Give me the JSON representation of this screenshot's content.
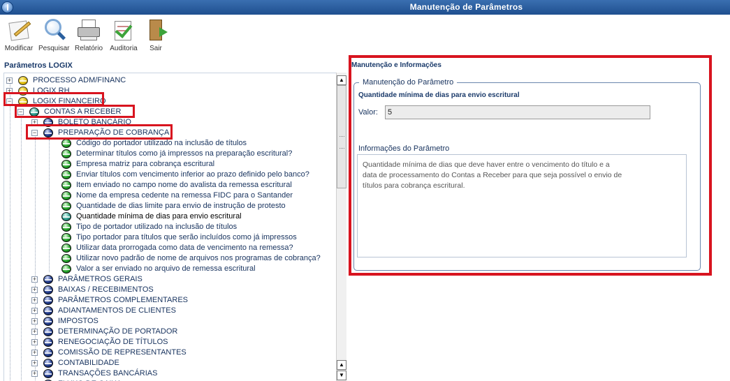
{
  "window": {
    "title": "Manutenção de Parâmetros"
  },
  "toolbar": {
    "modify": {
      "label": "Modificar",
      "icon": "edit-pen-icon"
    },
    "search": {
      "label": "Pesquisar",
      "icon": "magnifier-icon"
    },
    "report": {
      "label": "Relatório",
      "icon": "printer-icon"
    },
    "audit": {
      "label": "Auditoria",
      "icon": "checklist-icon"
    },
    "exit": {
      "label": "Sair",
      "icon": "exit-door-icon"
    }
  },
  "left_panel": {
    "title": "Parâmetros LOGIX",
    "tree": [
      {
        "label": "PROCESSO ADM/FINANC",
        "level": 0,
        "toggle": "+",
        "ball": "yellow"
      },
      {
        "label": "LOGIX RH",
        "level": 0,
        "toggle": "+",
        "ball": "yellow"
      },
      {
        "label": "LOGIX FINANCEIRO",
        "level": 0,
        "toggle": "-",
        "ball": "yellow"
      },
      {
        "label": "CONTAS A RECEBER",
        "level": 1,
        "toggle": "-",
        "ball": "teal"
      },
      {
        "label": "BOLETO BANCÁRIO",
        "level": 2,
        "toggle": "+",
        "ball": "navy"
      },
      {
        "label": "PREPARAÇÃO DE COBRANÇA",
        "level": 2,
        "toggle": "-",
        "ball": "navy"
      },
      {
        "label": "Código do portador utilizado na inclusão de títulos",
        "level": 3,
        "ball": "green"
      },
      {
        "label": "Determinar títulos como já impressos na preparação escritural?",
        "level": 3,
        "ball": "green"
      },
      {
        "label": "Empresa matriz para cobrança escritural",
        "level": 3,
        "ball": "green"
      },
      {
        "label": "Enviar títulos com vencimento inferior ao prazo definido pelo banco?",
        "level": 3,
        "ball": "green"
      },
      {
        "label": "Item enviado no campo nome do avalista da remessa escritural",
        "level": 3,
        "ball": "green"
      },
      {
        "label": "Nome da empresa cedente na remessa FIDC para o Santander",
        "level": 3,
        "ball": "green"
      },
      {
        "label": "Quantidade de dias limite para envio de instrução de protesto",
        "level": 3,
        "ball": "green"
      },
      {
        "label": "Quantidade mínima de dias para envio escritural",
        "level": 3,
        "ball": "teal",
        "selected": true
      },
      {
        "label": "Tipo de portador utilizado na inclusão de títulos",
        "level": 3,
        "ball": "green"
      },
      {
        "label": "Tipo portador para títulos que serão incluídos como já impressos",
        "level": 3,
        "ball": "green"
      },
      {
        "label": "Utilizar data prorrogada como data de vencimento na remessa?",
        "level": 3,
        "ball": "green"
      },
      {
        "label": "Utilizar novo padrão de nome de arquivos nos programas de cobrança?",
        "level": 3,
        "ball": "green"
      },
      {
        "label": "Valor a ser enviado no arquivo de remessa escritural",
        "level": 3,
        "ball": "green"
      },
      {
        "label": "PARÂMETROS GERAIS",
        "level": 2,
        "toggle": "+",
        "ball": "navy"
      },
      {
        "label": "BAIXAS / RECEBIMENTOS",
        "level": 2,
        "toggle": "+",
        "ball": "navy"
      },
      {
        "label": "PARÂMETROS COMPLEMENTARES",
        "level": 2,
        "toggle": "+",
        "ball": "navy"
      },
      {
        "label": "ADIANTAMENTOS DE CLIENTES",
        "level": 2,
        "toggle": "+",
        "ball": "navy"
      },
      {
        "label": "IMPOSTOS",
        "level": 2,
        "toggle": "+",
        "ball": "navy"
      },
      {
        "label": "DETERMINAÇÃO DE PORTADOR",
        "level": 2,
        "toggle": "+",
        "ball": "navy"
      },
      {
        "label": "RENEGOCIAÇÃO DE TÍTULOS",
        "level": 2,
        "toggle": "+",
        "ball": "navy"
      },
      {
        "label": "COMISSÃO DE REPRESENTANTES",
        "level": 2,
        "toggle": "+",
        "ball": "navy"
      },
      {
        "label": "CONTABILIDADE",
        "level": 2,
        "toggle": "+",
        "ball": "navy"
      },
      {
        "label": "TRANSAÇÕES BANCÁRIAS",
        "level": 2,
        "toggle": "+",
        "ball": "navy"
      },
      {
        "label": "FLUXO DE CAIXA",
        "level": 2,
        "toggle": "+",
        "ball": "navy"
      }
    ]
  },
  "right_panel": {
    "title": "Manutenção e Informações",
    "group_title": "Manutenção do Parâmetro",
    "param_name": "Quantidade mínima de dias para envio escritural",
    "valor_label": "Valor:",
    "valor": "5",
    "info_label": "Informações do Parâmetro",
    "info_lines": [
      "Quantidade mínima de dias que deve haver entre o vencimento do título e a",
      "data de processamento do Contas a Receber para que seja possível o envio de",
      "títulos para cobrança escritural."
    ]
  },
  "colors": {
    "highlight": "#d8141f",
    "titlebar": "#2a5f9e",
    "tree_text": "#1a3560"
  }
}
